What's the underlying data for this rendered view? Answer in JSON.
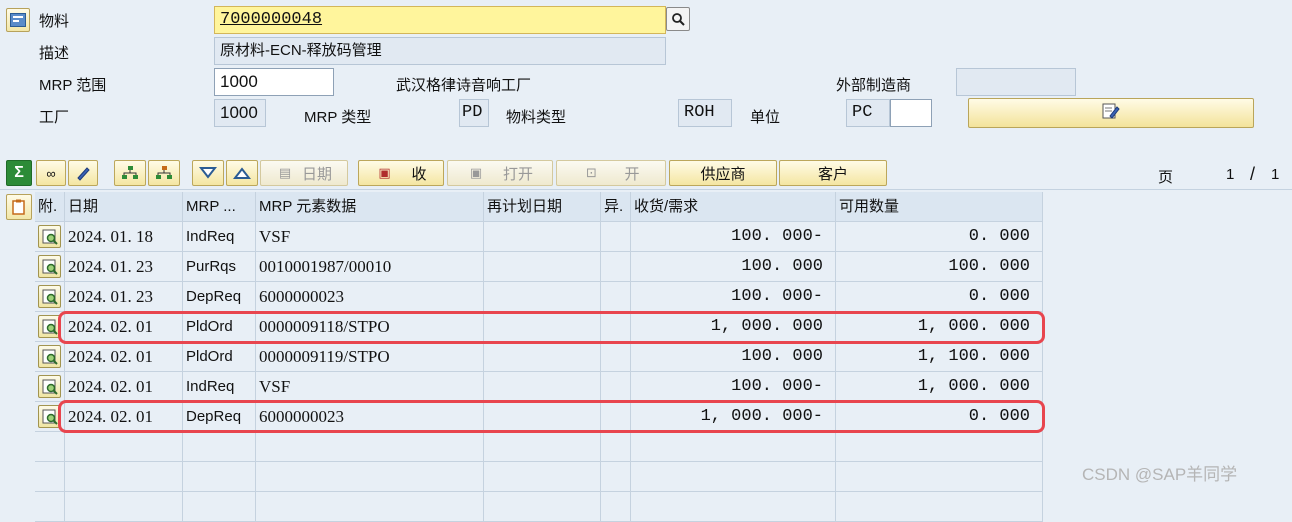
{
  "header": {
    "material_label": "物料",
    "material_value": "7000000048",
    "desc_label": "描述",
    "desc_value": "原材料-ECN-释放码管理",
    "mrp_area_label": "MRP 范围",
    "mrp_area_value": "1000",
    "plant_name": "武汉格律诗音响工厂",
    "ext_mfr_label": "外部制造商",
    "ext_mfr_value": "",
    "plant_label": "工厂",
    "plant_value": "1000",
    "mrp_type_label": "MRP 类型",
    "mrp_type_value": "PD",
    "mat_type_label": "物料类型",
    "mat_type_value": "ROH",
    "unit_label": "单位",
    "unit_value": "PC",
    "unit_extra": ""
  },
  "toolbar": {
    "date_label": "日期",
    "receive_label": "收",
    "open_label": "打开",
    "open2_label": "开",
    "vendor_label": "供应商",
    "customer_label": "客户",
    "page_label": "页",
    "page_current": "1",
    "page_sep": "/",
    "page_total": "1"
  },
  "table": {
    "columns": [
      "附.",
      "日期",
      "MRP ...",
      "MRP 元素数据",
      "再计划日期",
      "异.",
      "收货/需求",
      "可用数量"
    ],
    "rows": [
      {
        "date": "2024. 01. 18",
        "type": "IndReq",
        "data": "VSF",
        "resched": "",
        "exc": "",
        "qty": "100. 000-",
        "avail": "0. 000"
      },
      {
        "date": "2024. 01. 23",
        "type": "PurRqs",
        "data": "0010001987/00010",
        "resched": "",
        "exc": "",
        "qty": "100. 000",
        "avail": "100. 000"
      },
      {
        "date": "2024. 01. 23",
        "type": "DepReq",
        "data": "6000000023",
        "resched": "",
        "exc": "",
        "qty": "100. 000-",
        "avail": "0. 000"
      },
      {
        "date": "2024. 02. 01",
        "type": "PldOrd",
        "data": "0000009118/STPO",
        "resched": "",
        "exc": "",
        "qty": "1, 000. 000",
        "avail": "1, 000. 000"
      },
      {
        "date": "2024. 02. 01",
        "type": "PldOrd",
        "data": "0000009119/STPO",
        "resched": "",
        "exc": "",
        "qty": "100. 000",
        "avail": "1, 100. 000"
      },
      {
        "date": "2024. 02. 01",
        "type": "IndReq",
        "data": "VSF",
        "resched": "",
        "exc": "",
        "qty": "100. 000-",
        "avail": "1, 000. 000"
      },
      {
        "date": "2024. 02. 01",
        "type": "DepReq",
        "data": "6000000023",
        "resched": "",
        "exc": "",
        "qty": "1, 000. 000-",
        "avail": "0. 000"
      }
    ]
  },
  "watermark": "CSDN @SAP羊同学",
  "colors": {
    "highlight": "#e8454e",
    "field_yellow": "#fff59c",
    "bg": "#e8eff6"
  }
}
